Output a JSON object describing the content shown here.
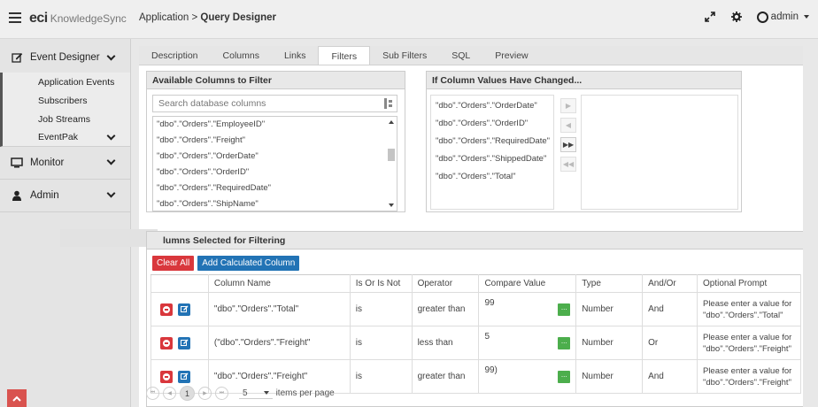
{
  "header": {
    "logo_eci": "eci",
    "logo_product": "KnowledgeSync",
    "breadcrumb_prefix": "Application >",
    "breadcrumb_current": "Query Designer",
    "user": "admin"
  },
  "sidebar": {
    "event_designer": "Event Designer",
    "sub_items": [
      "Application Events",
      "Subscribers",
      "Job Streams",
      "EventPak"
    ],
    "monitor": "Monitor",
    "admin": "Admin"
  },
  "tabs": [
    "Description",
    "Columns",
    "Links",
    "Filters",
    "Sub Filters",
    "SQL",
    "Preview"
  ],
  "active_tab": "Filters",
  "available": {
    "title": "Available Columns to Filter",
    "search_placeholder": "Search database columns",
    "items": [
      "\"dbo\".\"Orders\".\"EmployeeID\"",
      "\"dbo\".\"Orders\".\"Freight\"",
      "\"dbo\".\"Orders\".\"OrderDate\"",
      "\"dbo\".\"Orders\".\"OrderID\"",
      "\"dbo\".\"Orders\".\"RequiredDate\"",
      "\"dbo\".\"Orders\".\"ShipName\""
    ]
  },
  "changed": {
    "title": "If Column Values Have Changed...",
    "items": [
      "\"dbo\".\"Orders\".\"OrderDate\"",
      "\"dbo\".\"Orders\".\"OrderID\"",
      "\"dbo\".\"Orders\".\"RequiredDate\"",
      "\"dbo\".\"Orders\".\"ShippedDate\"",
      "\"dbo\".\"Orders\".\"Total\""
    ]
  },
  "selected": {
    "title": "lumns Selected for Filtering",
    "clear_all": "Clear All",
    "add_calc": "Add Calculated Column",
    "columns": [
      "Column Name",
      "Is Or Is Not",
      "Operator",
      "Compare Value",
      "Type",
      "And/Or",
      "Optional Prompt"
    ],
    "rows": [
      {
        "column": "\"dbo\".\"Orders\".\"Total\"",
        "is": "is",
        "operator": "greater than",
        "compare": "99",
        "type": "Number",
        "andor": "And",
        "prompt": "Please enter a value for \"dbo\".\"Orders\".\"Total\""
      },
      {
        "column": "(\"dbo\".\"Orders\".\"Freight\"",
        "is": "is",
        "operator": "less than",
        "compare": "5",
        "type": "Number",
        "andor": "Or",
        "prompt": "Please enter a value for \"dbo\".\"Orders\".\"Freight\""
      },
      {
        "column": "\"dbo\".\"Orders\".\"Freight\"",
        "is": "is",
        "operator": "greater than",
        "compare": "99)",
        "type": "Number",
        "andor": "And",
        "prompt": "Please enter a value for \"dbo\".\"Orders\".\"Freight\""
      }
    ],
    "compare_btn": "...",
    "pager": {
      "page": "1",
      "per_page": "5",
      "per_page_label": "items per page"
    }
  }
}
